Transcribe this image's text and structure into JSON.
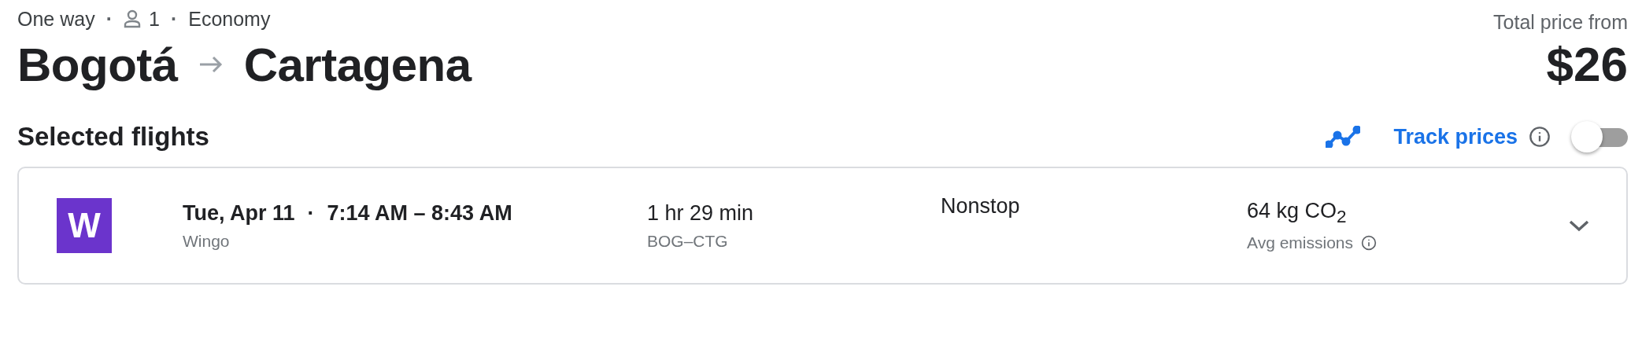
{
  "trip": [
    {
      "kind": "text",
      "text": "One way"
    },
    {
      "kind": "separator",
      "text": "·"
    },
    {
      "kind": "passengers",
      "text": "1"
    },
    {
      "kind": "separator",
      "text": "·"
    },
    {
      "kind": "text",
      "text": "Economy"
    }
  ],
  "route": {
    "origin": "Bogotá",
    "destination": "Cartagena"
  },
  "price": {
    "label": "Total price from",
    "amount": "$26"
  },
  "section_title": "Selected flights",
  "track_prices": {
    "label": "Track prices",
    "on": false
  },
  "flights": [
    {
      "logo_letter": "W",
      "date": "Tue, Apr 11",
      "separator": "·",
      "times": "7:14 AM – 8:43 AM",
      "airline": "Wingo",
      "duration": "1 hr 29 min",
      "route": "BOG–CTG",
      "stops": "Nonstop",
      "emissions": "64 kg CO$_{2}$",
      "emissions_label": "Avg emissions",
      "expanded": false
    }
  ]
}
